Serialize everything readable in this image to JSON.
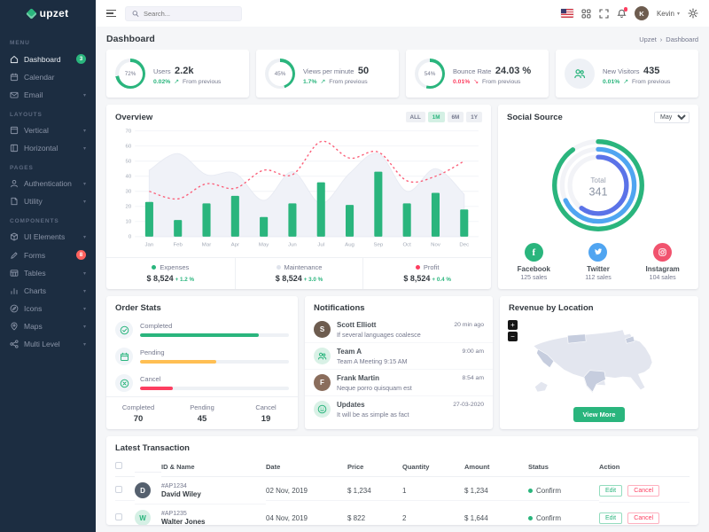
{
  "brand": {
    "name": "upzet"
  },
  "topbar": {
    "search_placeholder": "Search...",
    "user": {
      "name": "Kevin"
    }
  },
  "page": {
    "title": "Dashboard",
    "breadcrumb_parent": "Upzet",
    "breadcrumb_separator": "›",
    "breadcrumb_current": "Dashboard"
  },
  "sidebar": {
    "sections": [
      {
        "label": "Menu",
        "items": [
          {
            "label": "Dashboard",
            "icon": "home",
            "badge": "3",
            "badge_color": "#2ab57d",
            "active": true
          },
          {
            "label": "Calendar",
            "icon": "calendar"
          },
          {
            "label": "Email",
            "icon": "mail",
            "chevron": true
          }
        ]
      },
      {
        "label": "Layouts",
        "items": [
          {
            "label": "Vertical",
            "icon": "layout-vertical",
            "chevron": true
          },
          {
            "label": "Horizontal",
            "icon": "layout-horizontal",
            "chevron": true
          }
        ]
      },
      {
        "label": "Pages",
        "items": [
          {
            "label": "Authentication",
            "icon": "user",
            "chevron": true
          },
          {
            "label": "Utility",
            "icon": "file",
            "chevron": true
          }
        ]
      },
      {
        "label": "Components",
        "items": [
          {
            "label": "UI Elements",
            "icon": "box",
            "chevron": true
          },
          {
            "label": "Forms",
            "icon": "pen",
            "badge": "8",
            "badge_color": "#fd625e"
          },
          {
            "label": "Tables",
            "icon": "table",
            "chevron": true
          },
          {
            "label": "Charts",
            "icon": "bar-chart",
            "chevron": true
          },
          {
            "label": "Icons",
            "icon": "compass",
            "chevron": true
          },
          {
            "label": "Maps",
            "icon": "map-pin",
            "chevron": true
          },
          {
            "label": "Multi Level",
            "icon": "share",
            "chevron": true
          }
        ]
      }
    ]
  },
  "stats": [
    {
      "title": "Users",
      "value": "2.2k",
      "gauge_percent": 72,
      "gauge_label": "72%",
      "change": "0.02%",
      "direction": "up",
      "change_color": "#2ab57d",
      "note": "From previous"
    },
    {
      "title": "Views per minute",
      "value": "50",
      "gauge_percent": 45,
      "gauge_label": "45%",
      "change": "1.7%",
      "direction": "up",
      "change_color": "#2ab57d",
      "note": "From previous"
    },
    {
      "title": "Bounce Rate",
      "value": "24.03 %",
      "gauge_percent": 54,
      "gauge_label": "54%",
      "change": "0.01%",
      "direction": "down",
      "change_color": "#fd3e60",
      "note": "From previous"
    },
    {
      "title": "New Visitors",
      "value": "435",
      "icon": "team",
      "change": "0.01%",
      "direction": "up",
      "change_color": "#2ab57d",
      "note": "From previous"
    }
  ],
  "overview": {
    "title": "Overview",
    "ranges": [
      {
        "label": "ALL",
        "active": false
      },
      {
        "label": "1M",
        "active": true
      },
      {
        "label": "6M",
        "active": false
      },
      {
        "label": "1Y",
        "active": false
      }
    ],
    "legend": [
      {
        "name": "Expenses",
        "color": "#2ab57d",
        "amount": "$ 8,524",
        "change": "+ 1.2 %"
      },
      {
        "name": "Maintenance",
        "color": "#dfe3ec",
        "amount": "$ 8,524",
        "change": "+ 3.0 %"
      },
      {
        "name": "Profit",
        "color": "#fd3e60",
        "amount": "$ 8,524",
        "change": "+ 0.4 %"
      }
    ]
  },
  "chart_data": {
    "type": "mixed",
    "categories": [
      "Jan",
      "Feb",
      "Mar",
      "Apr",
      "May",
      "Jun",
      "Jul",
      "Aug",
      "Sep",
      "Oct",
      "Nov",
      "Dec"
    ],
    "series": [
      {
        "name": "Expenses",
        "type": "bar",
        "color": "#2ab57d",
        "values": [
          23,
          11,
          22,
          27,
          13,
          22,
          36,
          21,
          43,
          22,
          29,
          18
        ]
      },
      {
        "name": "Maintenance",
        "type": "area",
        "color": "#f0f2f8",
        "values": [
          44,
          55,
          41,
          42,
          24,
          43,
          22,
          42,
          55,
          30,
          45,
          28
        ]
      },
      {
        "name": "Profit",
        "type": "line-dashed",
        "color": "#fb5d77",
        "values": [
          30,
          25,
          35,
          32,
          44,
          41,
          63,
          52,
          56,
          37,
          40,
          50
        ]
      }
    ],
    "ylim": [
      0,
      70
    ],
    "yticks": [
      0,
      10,
      20,
      30,
      40,
      50,
      60,
      70
    ],
    "grid": true,
    "legend_position": "bottom"
  },
  "social": {
    "title": "Social Source",
    "period_options": [
      "May"
    ],
    "selected_period": "May",
    "total_label": "Total",
    "total": "341",
    "rings": [
      {
        "name": "Facebook",
        "color": "#2ab57d",
        "percent": 90
      },
      {
        "name": "Twitter",
        "color": "#50a5f1",
        "percent": 68
      },
      {
        "name": "Instagram",
        "color": "#5b73e8",
        "percent": 60
      }
    ],
    "channels": [
      {
        "name": "Facebook",
        "sales": "125 sales",
        "color": "#2ab57d",
        "icon": "facebook"
      },
      {
        "name": "Twitter",
        "sales": "112 sales",
        "color": "#50a5f1",
        "icon": "twitter"
      },
      {
        "name": "Instagram",
        "sales": "104 sales",
        "color": "#f1536e",
        "icon": "instagram"
      }
    ]
  },
  "order_stats": {
    "title": "Order Stats",
    "rows": [
      {
        "label": "Completed",
        "icon": "check",
        "color": "#2ab57d",
        "percent": 80
      },
      {
        "label": "Pending",
        "icon": "calendar",
        "color": "#ffbf53",
        "percent": 51
      },
      {
        "label": "Cancel",
        "icon": "close",
        "color": "#fd3e60",
        "percent": 22
      }
    ],
    "summary": [
      {
        "label": "Completed",
        "value": "70"
      },
      {
        "label": "Pending",
        "value": "45"
      },
      {
        "label": "Cancel",
        "value": "19"
      }
    ]
  },
  "notifications": {
    "title": "Notifications",
    "items": [
      {
        "name": "Scott Elliott",
        "message": "If several languages coalesce",
        "time": "20 min ago",
        "avatar_type": "photo",
        "initial": "S",
        "avatar_bg": "#6d5c4f"
      },
      {
        "name": "Team A",
        "message": "Team A Meeting 9:15 AM",
        "time": "9:00 am",
        "avatar_type": "icon",
        "icon": "team"
      },
      {
        "name": "Frank Martin",
        "message": "Neque porro quisquam est",
        "time": "8:54 am",
        "avatar_type": "photo",
        "initial": "F",
        "avatar_bg": "#8a6d5c"
      },
      {
        "name": "Updates",
        "message": "It will be as simple as fact",
        "time": "27-03-2020",
        "avatar_type": "icon",
        "icon": "smile"
      }
    ]
  },
  "revenue": {
    "title": "Revenue by Location",
    "button": "View More",
    "zoom_in": "+",
    "zoom_out": "−"
  },
  "transactions": {
    "title": "Latest Transaction",
    "columns": [
      "ID & Name",
      "Date",
      "Price",
      "Quantity",
      "Amount",
      "Status",
      "Action"
    ],
    "rows": [
      {
        "id": "#AP1234",
        "name": "David Wiley",
        "date": "02 Nov, 2019",
        "price": "$ 1,234",
        "quantity": "1",
        "amount": "$ 1,234",
        "status": "Confirm",
        "status_color": "#2ab57d",
        "avatar_type": "photo",
        "initial": "D",
        "avatar_bg": "#55606e",
        "actions": [
          "Edit",
          "Cancel"
        ]
      },
      {
        "id": "#AP1235",
        "name": "Walter Jones",
        "date": "04 Nov, 2019",
        "price": "$ 822",
        "quantity": "2",
        "amount": "$ 1,644",
        "status": "Confirm",
        "status_color": "#2ab57d",
        "avatar_type": "initial",
        "initial": "W",
        "actions": [
          "Edit",
          "Cancel"
        ]
      }
    ]
  }
}
